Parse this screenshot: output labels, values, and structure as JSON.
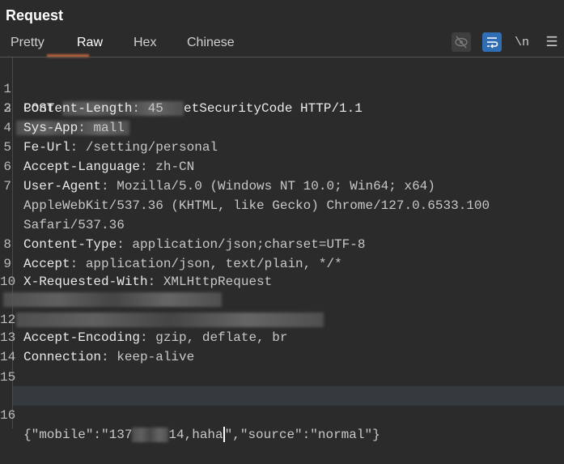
{
  "panel": {
    "title": "Request"
  },
  "tabs": [
    {
      "label": "Pretty",
      "active": false
    },
    {
      "label": "Raw",
      "active": true
    },
    {
      "label": "Hex",
      "active": false
    },
    {
      "label": "Chinese",
      "active": false
    }
  ],
  "toolbar": {
    "hide_icon": "eye-slash-icon",
    "wrap_icon": "word-wrap-icon",
    "newline_label": "\\n",
    "menu_icon": "hamburger-menu-icon",
    "accent": "#2f6db5"
  },
  "lines": [
    {
      "n": "1",
      "pre": "POST ",
      "post": "etSecurityCode HTTP/1.1"
    },
    {
      "n": "2"
    },
    {
      "n": "3",
      "name": "Content-Length",
      "value": ": 45"
    },
    {
      "n": "4",
      "name": "Sys-App",
      "value": ": mall"
    },
    {
      "n": "5",
      "name": "Fe-Url",
      "value": ": /setting/personal"
    },
    {
      "n": "6",
      "name": "Accept-Language",
      "value": ": zh-CN"
    },
    {
      "n": "7",
      "name": "User-Agent",
      "value": ": Mozilla/5.0 (Windows NT 10.0; Win64; x64)",
      "cont1": "AppleWebKit/537.36 (KHTML, like Gecko) Chrome/127.0.6533.100",
      "cont2": "Safari/537.36"
    },
    {
      "n": "8",
      "name": "Content-Type",
      "value": ": application/json;charset=UTF-8"
    },
    {
      "n": "9",
      "name": "Accept",
      "value": ": application/json, text/plain, */*"
    },
    {
      "n": "10",
      "name": "X-Requested-With",
      "value": ": XMLHttpRequest"
    },
    {
      "n": "11"
    },
    {
      "n": "12"
    },
    {
      "n": "13",
      "name": "Accept-Encoding",
      "value": ": gzip, deflate, br"
    },
    {
      "n": "14",
      "name": "Connection",
      "value": ": keep-alive"
    },
    {
      "n": "15"
    },
    {
      "n": "16",
      "pre": "{\"mobile\":\"137",
      "mid": "14,haha",
      "post": "\",\"source\":\"normal\"}"
    }
  ]
}
